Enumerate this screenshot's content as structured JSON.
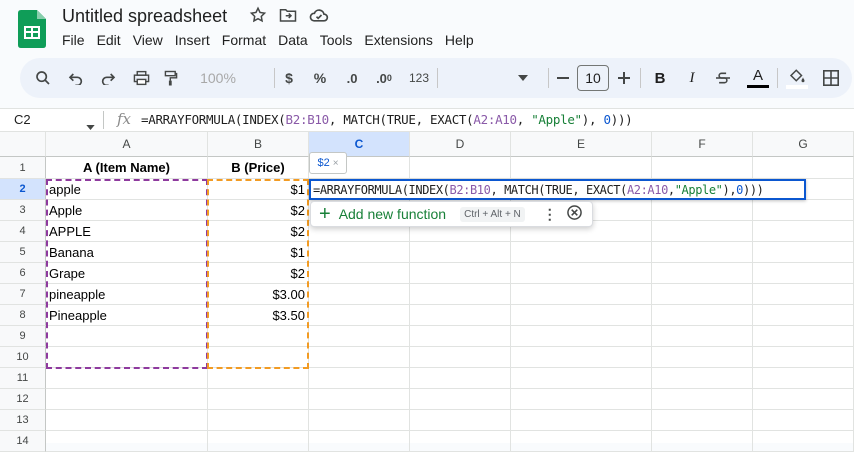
{
  "app": {
    "title": "Untitled spreadsheet",
    "menu": [
      "File",
      "Edit",
      "View",
      "Insert",
      "Format",
      "Data",
      "Tools",
      "Extensions",
      "Help"
    ]
  },
  "toolbar": {
    "zoom": "100%",
    "currency": "$",
    "percent": "%",
    "decrease_decimals": ".0",
    "number_format": "123",
    "font_size": "10",
    "bold": "B",
    "italic": "I",
    "text_color": "A"
  },
  "formula_bar": {
    "cell_ref": "C2",
    "fx": "fx",
    "formula_parts": [
      "=ARRAYFORMULA(INDEX(",
      "B2:B10",
      ", MATCH(TRUE, EXACT(",
      "A2:A10",
      ", ",
      "\"Apple\"",
      "), ",
      "0",
      ")))"
    ]
  },
  "grid": {
    "columns": [
      "A",
      "B",
      "C",
      "D",
      "E",
      "F",
      "G"
    ],
    "rows": [
      "1",
      "2",
      "3",
      "4",
      "5",
      "6",
      "7",
      "8",
      "9",
      "10",
      "11",
      "12",
      "13",
      "14"
    ],
    "header_a": "A (Item Name)",
    "header_b": "B (Price)",
    "items": [
      "apple",
      "Apple",
      "APPLE",
      "Banana",
      "Grape",
      "pineapple",
      "Pineapple"
    ],
    "prices": [
      "$1",
      "$2",
      "$2",
      "$1",
      "$2",
      "$3.00",
      "$3.50"
    ]
  },
  "editor": {
    "preview_chip": "$2",
    "chip_close": "×",
    "add_function_label": "Add new function",
    "shortcut": "Ctrl + Alt + N"
  }
}
